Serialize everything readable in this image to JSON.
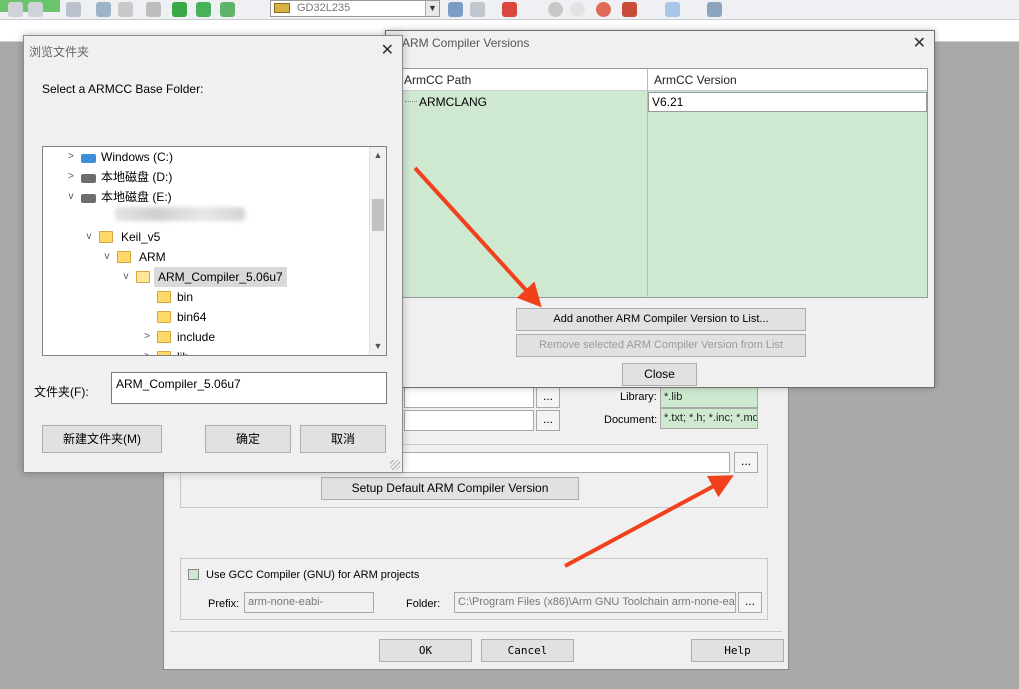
{
  "ide_toolbar": {
    "target_combo": "GD32L235"
  },
  "options_dialog": {
    "library_label": "Library:",
    "library_value": "*.lib",
    "document_label": "Document:",
    "document_value": "*.txt; *.h; *.inc; *.md",
    "browse_dots": "...",
    "setup_default_button": "Setup Default ARM Compiler Version",
    "use_gcc_checkbox": "Use GCC Compiler (GNU) for ARM projects",
    "prefix_label": "Prefix:",
    "prefix_value": "arm-none-eabi-",
    "folder_label": "Folder:",
    "folder_value": "C:\\Program Files (x86)\\Arm GNU Toolchain arm-none-eabi\\",
    "ok_button": "OK",
    "cancel_button": "Cancel",
    "help_button": "Help"
  },
  "acv_dialog": {
    "title": "ARM Compiler Versions",
    "columns": [
      "ArmCC Path",
      "ArmCC Version"
    ],
    "rows": [
      {
        "path": "ARMCLANG",
        "version": "V6.21"
      }
    ],
    "add_button": "Add another ARM Compiler Version to List...",
    "remove_button": "Remove selected ARM Compiler Version from List",
    "close_button": "Close"
  },
  "browse_dialog": {
    "title": "浏览文件夹",
    "prompt": "Select a ARMCC Base Folder:",
    "tree": [
      {
        "label": "Windows (C:)",
        "expander": ">",
        "icon": "windows-drive-icon"
      },
      {
        "label": "本地磁盘 (D:)",
        "expander": ">",
        "icon": "drive-icon"
      },
      {
        "label": "本地磁盘 (E:)",
        "expander": "v",
        "icon": "drive-icon"
      },
      {
        "label": "Keil_v5",
        "expander": "v",
        "icon": "folder-icon"
      },
      {
        "label": "ARM",
        "expander": "v",
        "icon": "folder-icon"
      },
      {
        "label": "ARM_Compiler_5.06u7",
        "expander": "v",
        "icon": "folder-open-icon"
      },
      {
        "label": "bin",
        "expander": "",
        "icon": "folder-icon"
      },
      {
        "label": "bin64",
        "expander": "",
        "icon": "folder-icon"
      },
      {
        "label": "include",
        "expander": ">",
        "icon": "folder-icon"
      },
      {
        "label": "lib",
        "expander": ">",
        "icon": "folder-icon"
      }
    ],
    "folder_field_label": "文件夹(F):",
    "folder_field_value": "ARM_Compiler_5.06u7",
    "new_folder_button": "新建文件夹(M)",
    "ok_button": "确定",
    "cancel_button": "取消"
  },
  "colors": {
    "grid_green": "#cfe8d0",
    "annotation_red": "#f0401c"
  }
}
